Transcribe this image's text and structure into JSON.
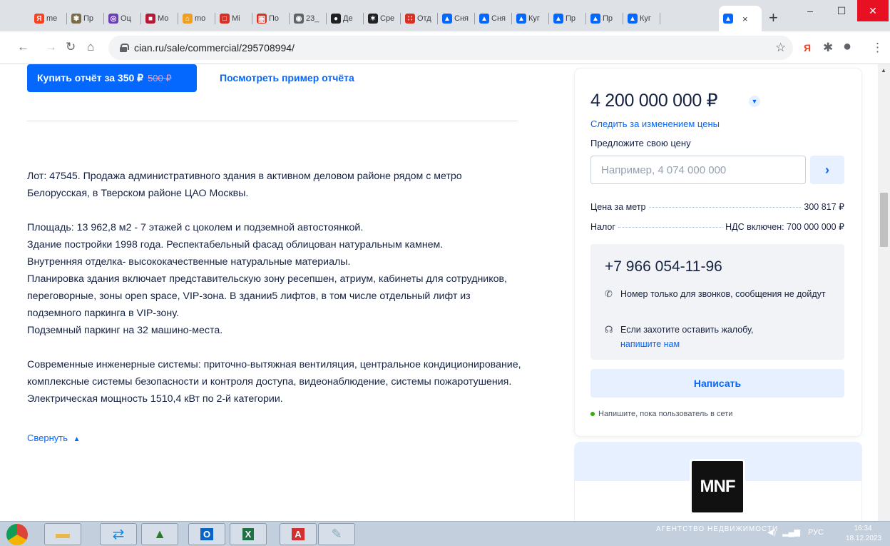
{
  "browser": {
    "tabs": [
      {
        "label": "me",
        "fav": "Я",
        "color": "#fc3f1d"
      },
      {
        "label": "Пр",
        "fav": "✾",
        "color": "#7a6b4a"
      },
      {
        "label": "Оц",
        "fav": "◎",
        "color": "#6a3fb5"
      },
      {
        "label": "Мо",
        "fav": "■",
        "color": "#b31b34"
      },
      {
        "label": "mo",
        "fav": "⌂",
        "color": "#f0a020"
      },
      {
        "label": "Mi",
        "fav": "□",
        "color": "#d93025"
      },
      {
        "label": "По",
        "fav": "圏",
        "color": "#d93025"
      },
      {
        "label": "23_",
        "fav": "◉",
        "color": "#5f6368"
      },
      {
        "label": "Де",
        "fav": "●",
        "color": "#202124"
      },
      {
        "label": "Сре",
        "fav": "✶",
        "color": "#202124"
      },
      {
        "label": "Отд",
        "fav": "∷",
        "color": "#d93025"
      },
      {
        "label": "Сня",
        "fav": "▲",
        "color": "#0468ff"
      },
      {
        "label": "Сня",
        "fav": "▲",
        "color": "#0468ff"
      },
      {
        "label": "Куг",
        "fav": "▲",
        "color": "#0468ff"
      },
      {
        "label": "Пр",
        "fav": "▲",
        "color": "#0468ff"
      },
      {
        "label": "Пр",
        "fav": "▲",
        "color": "#0468ff"
      },
      {
        "label": "Куг",
        "fav": "▲",
        "color": "#0468ff"
      }
    ],
    "active_tab_close": "×",
    "new_tab": "+",
    "url": "cian.ru/sale/commercial/295708994/"
  },
  "report": {
    "buy_label": "Купить отчёт за 350 ₽",
    "old_price": "500 ₽",
    "sample_link": "Посмотреть пример отчёта"
  },
  "description": {
    "p1": "Лот: 47545. Продажа административного здания в активном деловом районе рядом с метро Белорусская, в Тверском районе ЦАО Москвы.",
    "p2_lines": [
      "Площадь: 13 962,8 м2 - 7 этажей с цоколем и подземной автостоянкой.",
      "Здание постройки 1998 года. Респектабельный фасад облицован натуральным камнем.",
      "Внутренняя отделка- высококачественные натуральные материалы.",
      "Планировка здания включает представительскую зону ресепшен, атриум, кабинеты для сотрудников, переговорные, зоны open space, VIP-зона. В здании5 лифтов, в том числе отдельный лифт из подземного паркинга в VIP-зону.",
      "Подземный паркинг на 32 машино-места."
    ],
    "p3": "Современные инженерные системы: приточно-вытяжная вентиляция, центральное кондиционирование, комплексные системы безопасности и контроля доступа, видеонаблюдение, системы пожаротушения. Электрическая мощность  1510,4 кВт по 2-й категории.",
    "collapse": "Свернуть"
  },
  "card": {
    "price": "4 200 000 000 ₽",
    "watch_price": "Следить за изменением цены",
    "offer_label": "Предложите свою цену",
    "offer_placeholder": "Например, 4 074 000 000",
    "price_per_meter_label": "Цена за метр",
    "price_per_meter_value": "300 817 ₽",
    "tax_label": "Налог",
    "tax_value": "НДС включен: 700 000 000 ₽",
    "phone": "+7 966 054-11-96",
    "note_calls": "Номер только для звонков, сообщения не дойдут",
    "note_complaint": "Если захотите оставить жалобу,",
    "note_complaint_link": "напишите нам",
    "write_button": "Написать",
    "online_note": "Напишите, пока пользователь в сети"
  },
  "agency": {
    "logo_text": "MNF",
    "label": "АГЕНТСТВО НЕДВИЖИМОСТИ"
  },
  "taskbar": {
    "lang": "РУС",
    "time": "16:34",
    "date": "18.12.2023"
  },
  "colors": {
    "accent": "#0468ff",
    "accent_light": "#e7f0ff",
    "text": "#152242",
    "online": "#34ac0a"
  }
}
